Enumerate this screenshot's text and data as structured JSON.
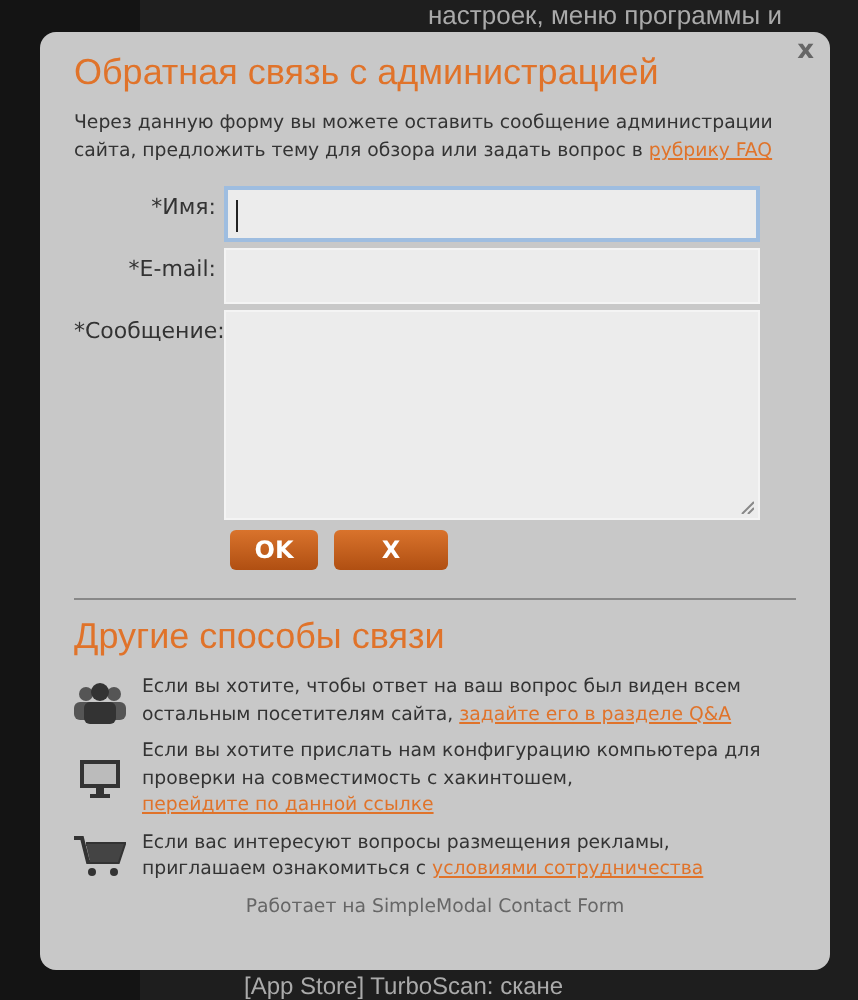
{
  "background_page": {
    "top_text": "настроек, меню программы и",
    "bottom_text": "[App Store] TurboScan: скане"
  },
  "modal": {
    "close": "x",
    "title": "Обратная связь с администрацией",
    "intro": "Через данную форму вы можете оставить сообщение администрации сайта, предложить тему для обзора или задать вопрос в",
    "intro_link": "рубрику FAQ",
    "fields": [
      {
        "label": "*Имя:",
        "kind": "input",
        "focused": true
      },
      {
        "label": "*E-mail:",
        "kind": "input",
        "focused": false
      },
      {
        "label": "*Сообщение:",
        "kind": "textarea",
        "focused": false
      }
    ],
    "buttons": [
      "OK",
      "X"
    ],
    "other_title": "Другие способы связи",
    "other": [
      {
        "kind": "people",
        "text": "Если вы хотите, чтобы ответ на ваш вопрос был виден всем остальным посетителям сайта,",
        "link": "задайте его в разделе Q&A"
      },
      {
        "kind": "monitor",
        "text": "Если вы хотите прислать нам конфигурацию компьютера для проверки на совместимость с хакинтошем,",
        "link": "перейдите по данной ссылке"
      },
      {
        "kind": "cart",
        "text": "Если вас интересуют вопросы размещения рекламы, приглашаем ознакомиться с",
        "link": "условиями сотрудничества"
      }
    ],
    "footer": "Работает на SimpleModal Contact Form"
  }
}
